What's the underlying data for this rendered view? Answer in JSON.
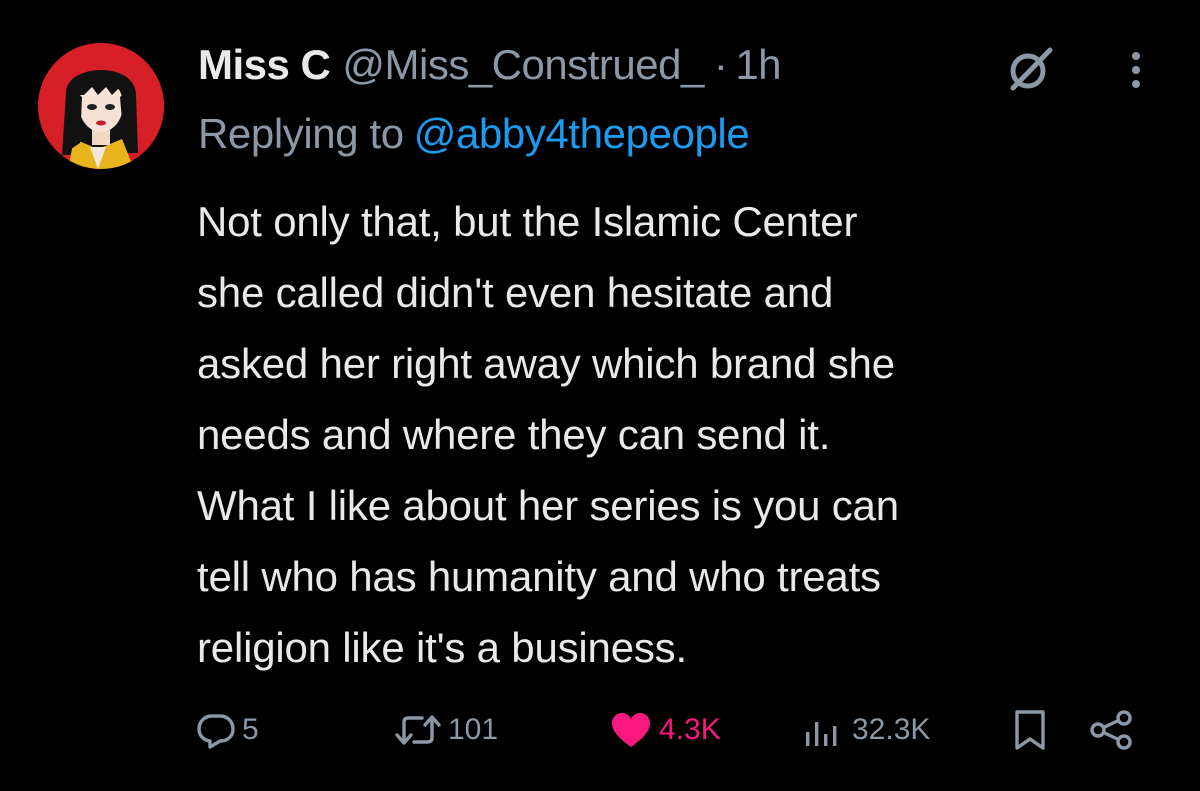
{
  "tweet": {
    "author": {
      "display_name": "Miss C",
      "handle": "@Miss_Construed_",
      "separator": "·",
      "time": "1h"
    },
    "reply": {
      "prefix": "Replying to",
      "handle": "@abby4thepeople"
    },
    "text_lines": [
      "Not only that, but the Islamic Center",
      "she called didn't even hesitate and",
      "asked her right away which brand she",
      "needs and where they can send it.",
      "What I like about her series is you can",
      "tell who has humanity and who treats",
      "religion like it's a business."
    ]
  },
  "actions": {
    "replies": "5",
    "reposts": "101",
    "likes": "4.3K",
    "views": "32.3K"
  },
  "icons": {
    "avatar": "profile-avatar",
    "grok": "grok-icon",
    "more": "more-icon",
    "reply": "reply-icon",
    "repost": "repost-icon",
    "like": "heart-icon",
    "views": "views-icon",
    "bookmark": "bookmark-icon",
    "share": "share-icon"
  },
  "colors": {
    "background": "#000000",
    "text": "#e7e9ea",
    "secondary": "#8b98a5",
    "link": "#1d9bf0",
    "like": "#f91880"
  }
}
